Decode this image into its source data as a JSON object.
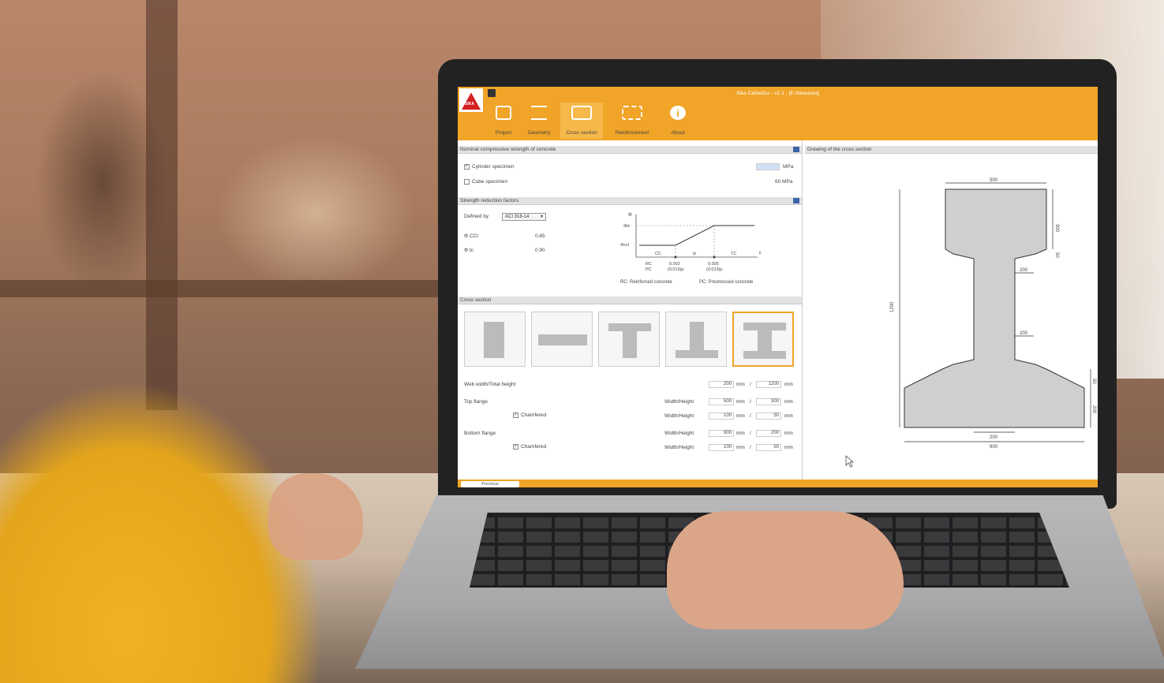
{
  "app": {
    "title": "Sika CarboDur - v1.1 - [E:\\Newacka]",
    "logo_text": "SIKA"
  },
  "ribbon": [
    {
      "label": "Project",
      "icon": "house-document-icon"
    },
    {
      "label": "Geometry",
      "icon": "beam-loads-icon"
    },
    {
      "label": "Cross section",
      "icon": "cross-section-icon",
      "active": true
    },
    {
      "label": "Reinforcement",
      "icon": "reinforcement-icon"
    },
    {
      "label": "About",
      "icon": "info-icon",
      "glyph": "i"
    }
  ],
  "strength": {
    "header": "Nominal compressive strength of concrete",
    "cylinder_label": "Cylinder specimen",
    "cylinder_checked": "✓",
    "cylinder_value": "",
    "cylinder_unit": "MPa",
    "cube_label": "Cube specimen",
    "cube_value": "60 MPa"
  },
  "reduction": {
    "header": "Strength reduction factors",
    "defined_by_label": "Defined by",
    "defined_by_value": "ACI 318-14",
    "phi_ccl_label": "Φ CCl",
    "phi_ccl_value": "0.65",
    "phi_tc_label": "Φ tc",
    "phi_tc_value": "0.90",
    "diagram": {
      "phi": "Φ",
      "phi_tc": "Φtc",
      "phi_ccl": "Φccl",
      "cc": "CC",
      "tz": "tz",
      "tc": "TC",
      "eps": "ε",
      "rc": "RC",
      "pc": "PC",
      "v1": "0.002",
      "v1b": "(0.013)p",
      "v2": "0.005",
      "v2b": "(0.013)p",
      "legend_rc": "RC: Reinforced concrete",
      "legend_pc": "PC: Prestressed concrete"
    }
  },
  "cross_section": {
    "header": "Cross section",
    "web_label": "Web width/Total height",
    "web_width": "200",
    "web_height": "1200",
    "top_flange_label": "Top flange",
    "top_chamfered": "Chamfered",
    "top_wh_label": "Width/Height",
    "top_width": "500",
    "top_height": "300",
    "top_ch_label": "Width/Height",
    "top_ch_width": "100",
    "top_ch_height": "50",
    "bottom_flange_label": "Bottom flange",
    "bottom_chamfered": "Chamfered",
    "bottom_wh_label": "Width/Height",
    "bottom_width": "900",
    "bottom_height": "200",
    "bottom_ch_label": "Width/Height",
    "bottom_ch_width": "100",
    "bottom_ch_height": "50",
    "unit_mm": "mm",
    "slash": "/"
  },
  "drawing": {
    "header": "Drawing of the cross section",
    "dim_top": "500",
    "dim_top_h": "300",
    "dim_top_ch": "50",
    "dim_web1": "200",
    "dim_web2": "200",
    "dim_total": "1200",
    "dim_bot_ch": "50",
    "dim_bot_h": "200",
    "dim_web_bottom": "200",
    "dim_bottom": "900"
  },
  "footer": {
    "previous": "Previous"
  }
}
